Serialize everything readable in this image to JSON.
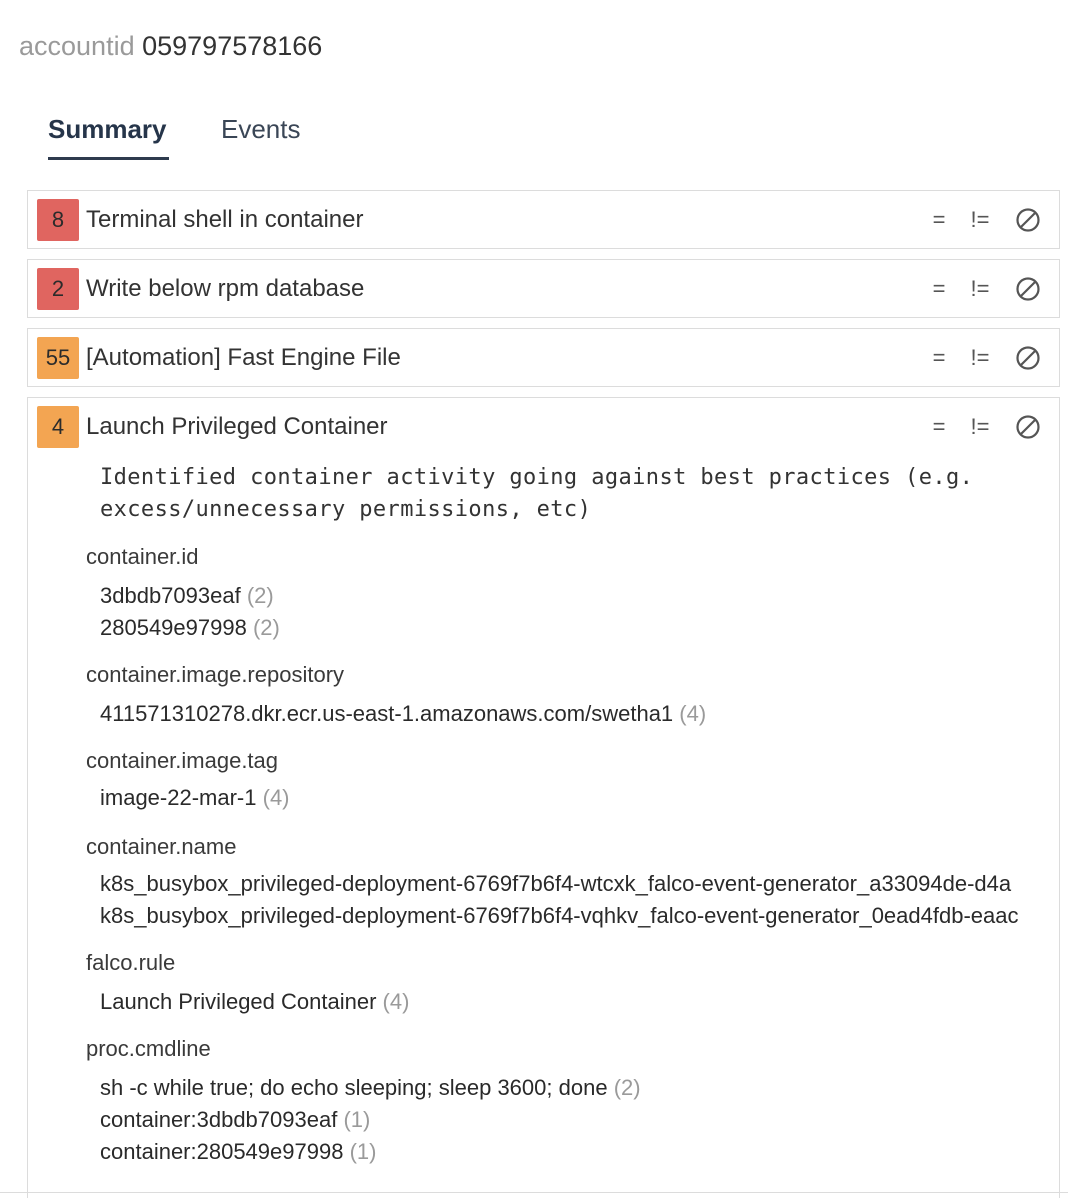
{
  "header": {
    "label": "accountid",
    "value": "059797578166"
  },
  "tabs": [
    {
      "label": "Summary",
      "active": true
    },
    {
      "label": "Events",
      "active": false
    }
  ],
  "actions": {
    "equals": "=",
    "not_equals": "!=",
    "block_icon": "block-icon"
  },
  "colors": {
    "red_badge": "#e06560",
    "orange_badge": "#f3a552"
  },
  "rules": [
    {
      "count": "8",
      "severity": "red",
      "name": "Terminal shell in container"
    },
    {
      "count": "2",
      "severity": "red",
      "name": "Write below rpm database"
    },
    {
      "count": "55",
      "severity": "orange",
      "name": "[Automation] Fast Engine File"
    },
    {
      "count": "4",
      "severity": "orange",
      "name": "Launch Privileged Container",
      "description_lines": [
        "Identified container activity going against best practices (e.g.",
        "excess/unnecessary permissions, etc)"
      ],
      "fields": [
        {
          "name": "container.id",
          "values": [
            {
              "value": "3dbdb7093eaf",
              "count": "(2)"
            },
            {
              "value": "280549e97998",
              "count": "(2)"
            }
          ]
        },
        {
          "name": "container.image.repository",
          "values": [
            {
              "value": "411571310278.dkr.ecr.us-east-1.amazonaws.com/swetha1",
              "count": "(4)"
            }
          ]
        },
        {
          "name": "container.image.tag",
          "values": [
            {
              "value": "image-22-mar-1",
              "count": "(4)"
            }
          ]
        },
        {
          "name": "container.name",
          "values": [
            {
              "value": "k8s_busybox_privileged-deployment-6769f7b6f4-wtcxk_falco-event-generator_a33094de-d4a",
              "count": ""
            },
            {
              "value": "k8s_busybox_privileged-deployment-6769f7b6f4-vqhkv_falco-event-generator_0ead4fdb-eaac",
              "count": ""
            }
          ]
        },
        {
          "name": "falco.rule",
          "values": [
            {
              "value": "Launch Privileged Container",
              "count": "(4)"
            }
          ]
        },
        {
          "name": "proc.cmdline",
          "values": [
            {
              "value": "sh -c while true; do echo sleeping; sleep 3600; done",
              "count": "(2)"
            },
            {
              "value": "container:3dbdb7093eaf",
              "count": "(1)"
            },
            {
              "value": "container:280549e97998",
              "count": "(1)"
            }
          ]
        }
      ]
    }
  ]
}
